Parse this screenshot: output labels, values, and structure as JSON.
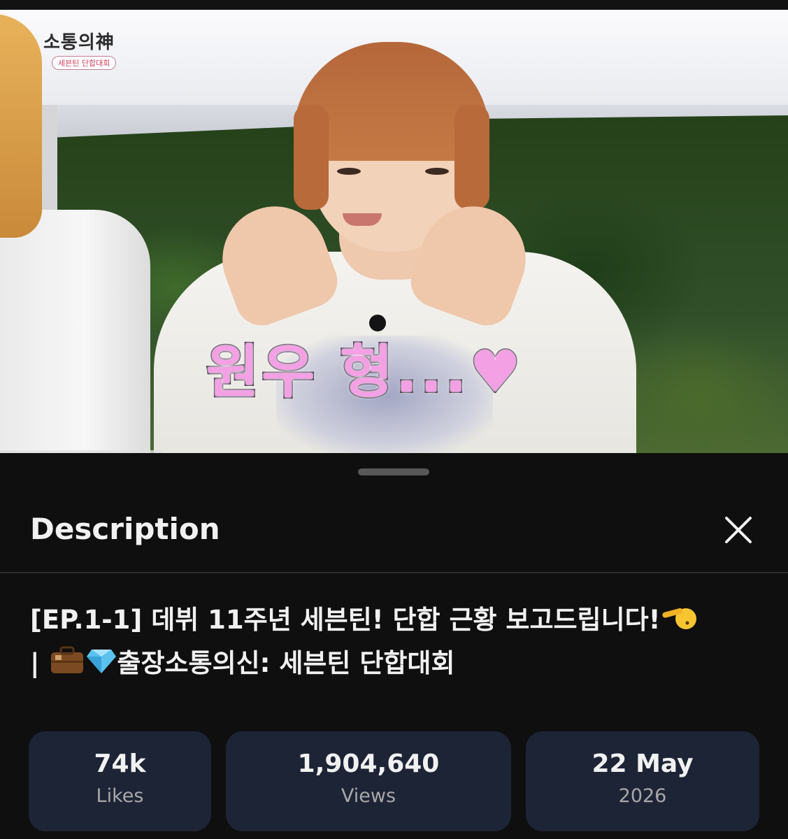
{
  "video": {
    "logo_title": "소통의神",
    "logo_subtitle": "세븐틴 단합대회",
    "caption": "원우 형...♥"
  },
  "sheet": {
    "title": "Description",
    "close_icon": "close-icon",
    "video_title_line1": "[EP.1-1] 데뷔 11주년 세븐틴! 단합 근황 보고드립니다!",
    "video_title_separator": "|",
    "video_title_line2": "출장소통의신: 세븐틴 단합대회",
    "title_emojis": [
      "saluting-face",
      "briefcase",
      "gem"
    ],
    "stats": {
      "likes": {
        "value": "74k",
        "label": "Likes"
      },
      "views": {
        "value": "1,904,640",
        "label": "Views"
      },
      "date": {
        "value": "22 May",
        "label": "2026"
      }
    }
  },
  "colors": {
    "background": "#0f0f0f",
    "stat_card": "#1d2436",
    "caption_pink": "#f4a0e4"
  }
}
